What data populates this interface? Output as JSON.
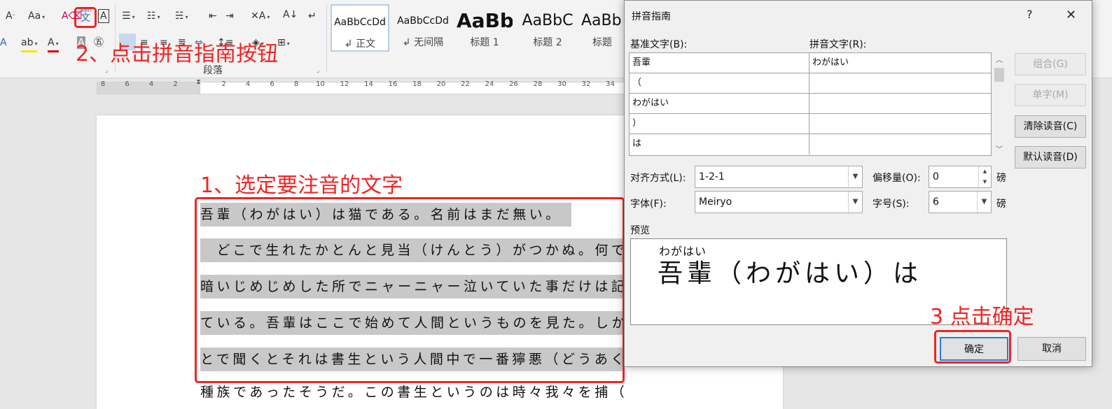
{
  "ribbon": {
    "paragraph_group_label": "段落",
    "phonetic_icon_glyph": "文",
    "phonetic_icon_ruby": "wén",
    "styles": [
      {
        "sample": "AaBbCcDd",
        "name": "↲ 正文"
      },
      {
        "sample": "AaBbCcDd",
        "name": "↲ 无间隔"
      },
      {
        "sample": "AaBb",
        "name": "标题 1"
      },
      {
        "sample": "AaBbC",
        "name": "标题 2"
      },
      {
        "sample": "AaBb",
        "name": "标题"
      }
    ]
  },
  "ruler": {
    "ticks": [
      "8",
      "6",
      "4",
      "2",
      "",
      "2",
      "4",
      "6",
      "8",
      "10",
      "12",
      "14",
      "16",
      "18",
      "20",
      "22",
      "24",
      "26",
      "28",
      "30",
      "32",
      "34"
    ]
  },
  "document": {
    "lines": [
      "吾輩（わがはい）は猫である。名前はまだ無い。",
      "　どこで生れたかとんと見当（けんとう）がつかぬ。何で",
      "暗いじめじめした所でニャーニャー泣いていた事だけは記",
      "ている。吾輩はここで始めて人間というものを見た。しか",
      "とで聞くとそれは書生という人間中で一番獰悪（どうあく",
      "種族であったそうだ。この書生というのは時々我々を捕（つか"
    ],
    "paragraph_mark": "↓"
  },
  "annotations": {
    "step1": "1、选定要注音的文字",
    "step2": "2、点击拼音指南按钮",
    "step3": "3 点击确定"
  },
  "dialog": {
    "title": "拼音指南",
    "help_glyph": "?",
    "close_glyph": "✕",
    "base_text_label": "基准文字(B):",
    "ruby_text_label": "拼音文字(R):",
    "rows": [
      {
        "base": "吾輩",
        "ruby": "わがはい"
      },
      {
        "base": "（",
        "ruby": ""
      },
      {
        "base": "わがはい",
        "ruby": ""
      },
      {
        "base": "）",
        "ruby": ""
      },
      {
        "base": "は",
        "ruby": ""
      }
    ],
    "buttons": {
      "group": "组合(G)",
      "mono": "单字(M)",
      "clear": "清除读音(C)",
      "default": "默认读音(D)",
      "ok": "确定",
      "cancel": "取消"
    },
    "alignment_label": "对齐方式(L):",
    "alignment_value": "1-2-1",
    "offset_label": "偏移量(O):",
    "offset_value": "0",
    "offset_unit": "磅",
    "font_label": "字体(F):",
    "font_value": "Meiryo",
    "size_label": "字号(S):",
    "size_value": "6",
    "size_unit": "磅",
    "preview_label": "预览",
    "preview_ruby": "わがはい",
    "preview_text": "吾輩（わがはい）は"
  }
}
